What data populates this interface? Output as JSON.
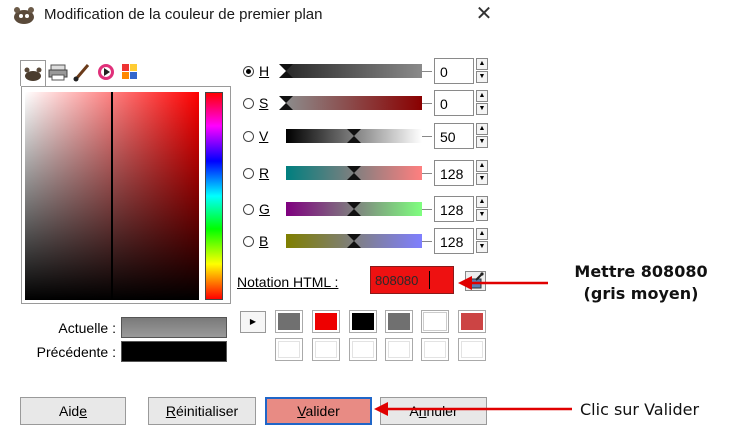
{
  "window": {
    "title": "Modification de la couleur de premier plan"
  },
  "sliders": [
    {
      "key": "H",
      "value": "0",
      "checked": true,
      "colors": [
        "#2a2a2a",
        "#8a8a8a"
      ],
      "level": 0.0
    },
    {
      "key": "S",
      "value": "0",
      "checked": false,
      "colors": [
        "#8c8c8c",
        "#8a0000"
      ],
      "level": 0.0
    },
    {
      "key": "V",
      "value": "50",
      "checked": false,
      "colors": [
        "#000000",
        "#ffffff"
      ],
      "level": 0.5
    },
    {
      "key": "R",
      "value": "128",
      "checked": false,
      "colors": [
        "#007f7f",
        "#ff7f7f"
      ],
      "level": 0.5
    },
    {
      "key": "G",
      "value": "128",
      "checked": false,
      "colors": [
        "#7f007f",
        "#7fff7f"
      ],
      "level": 0.5
    },
    {
      "key": "B",
      "value": "128",
      "checked": false,
      "colors": [
        "#7f7f00",
        "#7f7fff"
      ],
      "level": 0.5
    }
  ],
  "html_notation": {
    "label": "Notation HTML :",
    "value": "808080"
  },
  "current_label": "Actuelle :",
  "previous_label": "Précédente :",
  "history_row1": [
    "#707070",
    "#ee0000",
    "#000000",
    "#707070",
    "#ffffff",
    "#cc4444"
  ],
  "buttons": {
    "aide": {
      "pre": "Aid",
      "key": "e",
      "post": ""
    },
    "reinit": {
      "pre": "",
      "key": "R",
      "post": "éinitialiser"
    },
    "valider": {
      "pre": "",
      "key": "V",
      "post": "alider"
    },
    "annuler": {
      "pre": "A",
      "key": "n",
      "post": "nuler"
    }
  },
  "annotations": {
    "set_color": "Mettre 808080",
    "set_color_sub": "(gris moyen)",
    "click": "Clic sur Valider"
  },
  "colors": {
    "accent": "#e00000",
    "selected_border": "#2066c8"
  }
}
